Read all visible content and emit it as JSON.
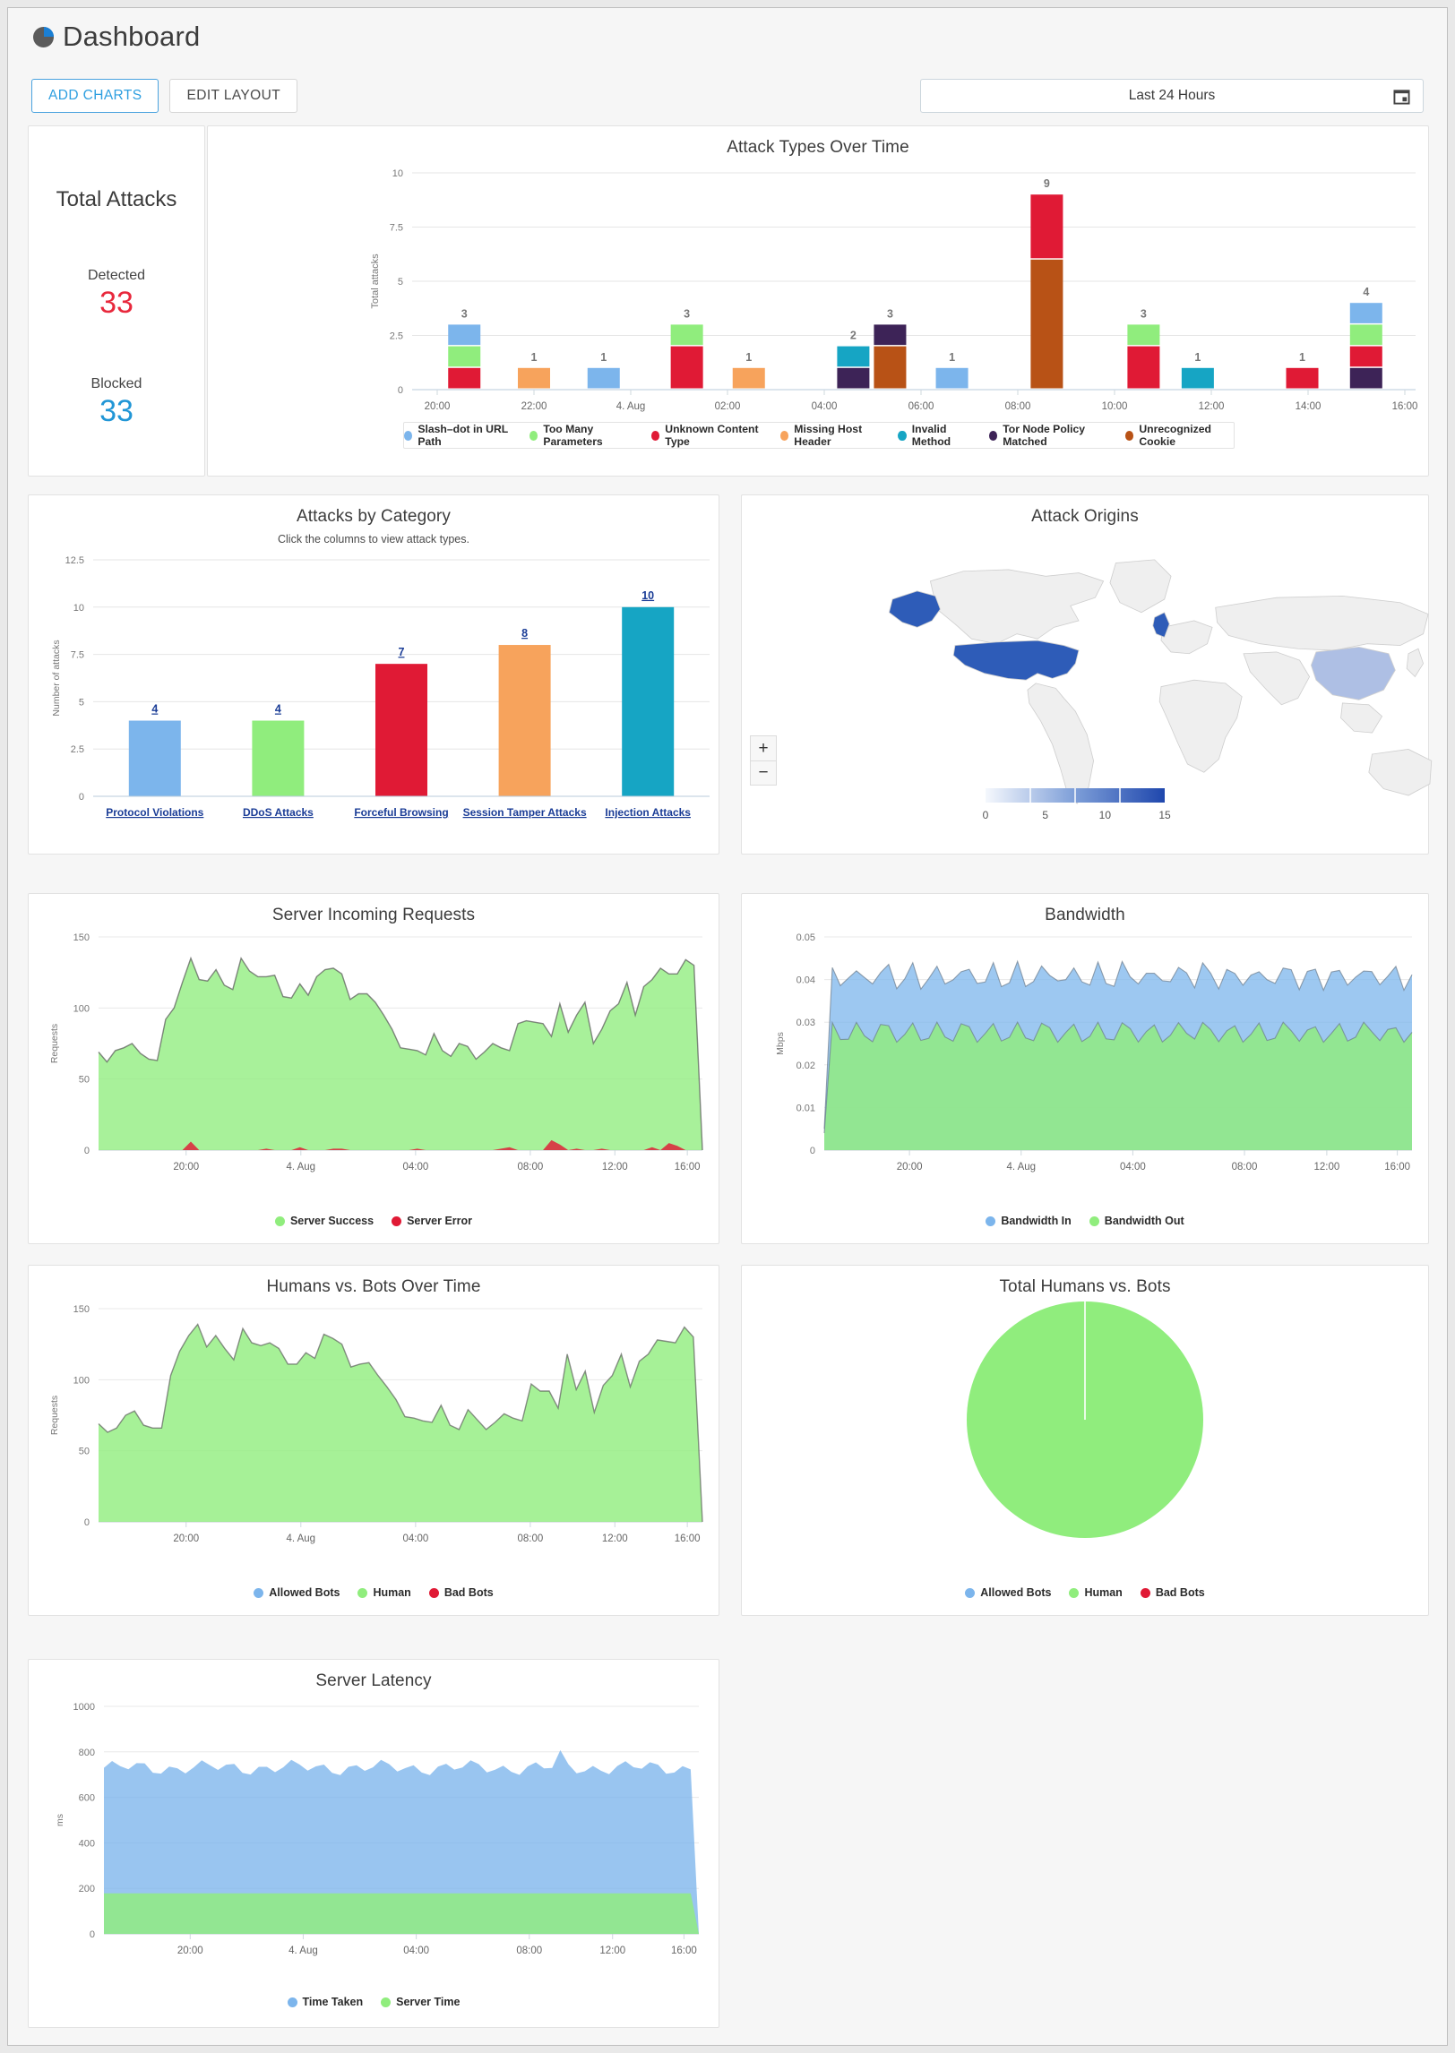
{
  "header": {
    "title": "Dashboard",
    "icon": "pie-chart-icon",
    "add_charts_label": "ADD CHARTS",
    "edit_layout_label": "EDIT LAYOUT",
    "time_range_value": "Last 24 Hours",
    "calendar_icon": "calendar-icon"
  },
  "total_attacks": {
    "title": "Total Attacks",
    "detected_label": "Detected",
    "detected_value": "33",
    "detected_color": "#e8283c",
    "blocked_label": "Blocked",
    "blocked_value": "33",
    "blocked_color": "#2196d6"
  },
  "map": {
    "zoom_in_label": "+",
    "zoom_out_label": "−",
    "legend_ticks": [
      "0",
      "5",
      "10",
      "15"
    ]
  },
  "chart_data": [
    {
      "id": "attack-types-over-time",
      "type": "bar",
      "title": "Attack Types Over Time",
      "xlabel": "",
      "ylabel": "Total attacks",
      "ylim": [
        0,
        10
      ],
      "yticks": [
        0,
        2.5,
        5,
        7.5,
        10
      ],
      "xticks": [
        "20:00",
        "22:00",
        "4. Aug",
        "02:00",
        "04:00",
        "06:00",
        "08:00",
        "10:00",
        "12:00",
        "14:00",
        "16:00"
      ],
      "stacked": true,
      "legend": [
        {
          "name": "Slash–dot in URL Path",
          "color": "#7cb5ec"
        },
        {
          "name": "Too Many Parameters",
          "color": "#90ed7d"
        },
        {
          "name": "Unknown Content Type",
          "color": "#e01a35"
        },
        {
          "name": "Missing Host Header",
          "color": "#f7a35c"
        },
        {
          "name": "Invalid Method",
          "color": "#16a5c4"
        },
        {
          "name": "Tor Node Policy Matched",
          "color": "#3d2357"
        },
        {
          "name": "Unrecognized Cookie",
          "color": "#b85216"
        }
      ],
      "bars": [
        {
          "time": "19:00",
          "total": 3,
          "segments": [
            {
              "series": "Unknown Content Type",
              "value": 1
            },
            {
              "series": "Too Many Parameters",
              "value": 1
            },
            {
              "series": "Slash–dot in URL Path",
              "value": 1
            }
          ]
        },
        {
          "time": "20:30",
          "total": 1,
          "segments": [
            {
              "series": "Missing Host Header",
              "value": 1
            }
          ]
        },
        {
          "time": "22:00",
          "total": 1,
          "segments": [
            {
              "series": "Slash–dot in URL Path",
              "value": 1
            }
          ]
        },
        {
          "time": "00:00",
          "total": 3,
          "segments": [
            {
              "series": "Unknown Content Type",
              "value": 2
            },
            {
              "series": "Too Many Parameters",
              "value": 1
            }
          ]
        },
        {
          "time": "01:00",
          "total": 1,
          "segments": [
            {
              "series": "Missing Host Header",
              "value": 1
            }
          ]
        },
        {
          "time": "04:00",
          "total": 2,
          "segments": [
            {
              "series": "Tor Node Policy Matched",
              "value": 1
            },
            {
              "series": "Invalid Method",
              "value": 1
            }
          ]
        },
        {
          "time": "04:45",
          "total": 3,
          "segments": [
            {
              "series": "Unrecognized Cookie",
              "value": 2
            },
            {
              "series": "Tor Node Policy Matched",
              "value": 1
            }
          ]
        },
        {
          "time": "06:00",
          "total": 1,
          "segments": [
            {
              "series": "Slash–dot in URL Path",
              "value": 1
            }
          ]
        },
        {
          "time": "08:20",
          "total": 9,
          "segments": [
            {
              "series": "Unrecognized Cookie",
              "value": 6
            },
            {
              "series": "Unknown Content Type",
              "value": 3
            }
          ]
        },
        {
          "time": "11:00",
          "total": 3,
          "segments": [
            {
              "series": "Unknown Content Type",
              "value": 2
            },
            {
              "series": "Too Many Parameters",
              "value": 1
            }
          ]
        },
        {
          "time": "12:00",
          "total": 1,
          "segments": [
            {
              "series": "Invalid Method",
              "value": 1
            }
          ]
        },
        {
          "time": "14:30",
          "total": 1,
          "segments": [
            {
              "series": "Unknown Content Type",
              "value": 1
            }
          ]
        },
        {
          "time": "15:45",
          "total": 4,
          "segments": [
            {
              "series": "Tor Node Policy Matched",
              "value": 1
            },
            {
              "series": "Unknown Content Type",
              "value": 1
            },
            {
              "series": "Too Many Parameters",
              "value": 1
            },
            {
              "series": "Slash–dot in URL Path",
              "value": 1
            }
          ]
        }
      ]
    },
    {
      "id": "attacks-by-category",
      "type": "bar",
      "title": "Attacks by Category",
      "subtitle": "Click the columns to view attack types.",
      "xlabel": "",
      "ylabel": "Number of attacks",
      "ylim": [
        0,
        12.5
      ],
      "yticks": [
        0,
        2.5,
        5,
        7.5,
        10,
        12.5
      ],
      "categories": [
        "Protocol Violations",
        "DDoS Attacks",
        "Forceful Browsing",
        "Session Tamper Attacks",
        "Injection Attacks"
      ],
      "values": [
        4,
        4,
        7,
        8,
        10
      ],
      "colors": [
        "#7cb5ec",
        "#90ed7d",
        "#e01a35",
        "#f7a35c",
        "#16a5c4"
      ],
      "label_color": "#1a3c96"
    },
    {
      "id": "attack-origins",
      "type": "heatmap",
      "title": "Attack Origins",
      "legend_ticks": [
        0,
        5,
        10,
        15
      ],
      "regions": [
        {
          "name": "United States",
          "value": 15
        },
        {
          "name": "Alaska",
          "value": 15
        },
        {
          "name": "United Kingdom",
          "value": 15
        },
        {
          "name": "China",
          "value": 5
        }
      ]
    },
    {
      "id": "server-incoming-requests",
      "type": "area",
      "title": "Server Incoming Requests",
      "xlabel": "",
      "ylabel": "Requests",
      "ylim": [
        0,
        150
      ],
      "yticks": [
        0,
        50,
        100,
        150
      ],
      "xticks": [
        "20:00",
        "4. Aug",
        "04:00",
        "08:00",
        "12:00",
        "16:00"
      ],
      "series": [
        {
          "name": "Server Success",
          "color": "#90ed7d",
          "values": [
            69,
            62,
            70,
            72,
            75,
            68,
            64,
            63,
            92,
            100,
            118,
            135,
            120,
            119,
            127,
            116,
            113,
            135,
            126,
            122,
            122,
            123,
            108,
            107,
            117,
            109,
            122,
            127,
            128,
            124,
            106,
            110,
            110,
            104,
            95,
            85,
            72,
            71,
            70,
            67,
            82,
            70,
            66,
            75,
            73,
            64,
            69,
            75,
            72,
            70,
            89,
            91,
            90,
            89,
            80,
            103,
            83,
            95,
            104,
            75,
            85,
            98,
            103,
            118,
            95,
            115,
            120,
            128,
            124,
            124,
            134,
            130,
            0
          ]
        },
        {
          "name": "Server Error",
          "color": "#e01a35",
          "values": [
            0,
            0,
            0,
            0,
            0,
            0,
            0,
            0,
            0,
            0,
            0,
            6,
            0,
            0,
            0,
            0,
            0,
            0,
            0,
            0,
            1,
            0,
            0,
            0,
            2,
            0,
            0,
            0,
            1,
            1,
            0,
            0,
            0,
            0,
            0,
            0,
            0,
            0,
            1,
            0,
            0,
            0,
            0,
            0,
            0,
            0,
            0,
            0,
            1,
            2,
            0,
            0,
            0,
            0,
            7,
            4,
            0,
            1,
            0,
            0,
            1,
            0,
            0,
            0,
            0,
            0,
            2,
            0,
            5,
            3,
            0,
            0,
            0
          ]
        }
      ]
    },
    {
      "id": "bandwidth",
      "type": "area",
      "title": "Bandwidth",
      "xlabel": "",
      "ylabel": "Mbps",
      "ylim": [
        0,
        0.05
      ],
      "yticks": [
        0,
        0.01,
        0.02,
        0.03,
        0.04,
        0.05
      ],
      "xticks": [
        "20:00",
        "4. Aug",
        "04:00",
        "08:00",
        "12:00",
        "16:00"
      ],
      "series": [
        {
          "name": "Bandwidth Out",
          "color": "#90ed7d",
          "approx_value": 0.028
        },
        {
          "name": "Bandwidth In",
          "color": "#7cb5ec",
          "approx_top": 0.042
        }
      ]
    },
    {
      "id": "humans-vs-bots-over-time",
      "type": "area",
      "title": "Humans vs. Bots Over Time",
      "xlabel": "",
      "ylabel": "Requests",
      "ylim": [
        0,
        150
      ],
      "yticks": [
        0,
        50,
        100,
        150
      ],
      "xticks": [
        "20:00",
        "4. Aug",
        "04:00",
        "08:00",
        "12:00",
        "16:00"
      ],
      "series": [
        {
          "name": "Allowed Bots",
          "color": "#7cb5ec",
          "values": []
        },
        {
          "name": "Human",
          "color": "#90ed7d",
          "values": [
            69,
            63,
            66,
            75,
            78,
            68,
            66,
            66,
            103,
            120,
            131,
            139,
            123,
            131,
            122,
            114,
            136,
            126,
            124,
            126,
            122,
            111,
            111,
            119,
            115,
            132,
            129,
            125,
            109,
            111,
            112,
            103,
            95,
            86,
            74,
            73,
            71,
            70,
            82,
            68,
            65,
            79,
            72,
            65,
            70,
            76,
            73,
            71,
            97,
            92,
            92,
            80,
            118,
            93,
            106,
            77,
            96,
            103,
            118,
            95,
            113,
            118,
            128,
            127,
            126,
            137,
            130,
            0
          ]
        },
        {
          "name": "Bad Bots",
          "color": "#e01a35",
          "values": []
        }
      ]
    },
    {
      "id": "total-humans-vs-bots",
      "type": "pie",
      "title": "Total Humans vs. Bots",
      "labels": [
        "Allowed Bots",
        "Human",
        "Bad Bots"
      ],
      "colors": [
        "#7cb5ec",
        "#90ed7d",
        "#e01a35"
      ],
      "values": [
        0,
        100,
        0
      ]
    },
    {
      "id": "server-latency",
      "type": "area",
      "title": "Server Latency",
      "xlabel": "",
      "ylabel": "ms",
      "ylim": [
        0,
        1000
      ],
      "yticks": [
        0,
        200,
        400,
        600,
        800,
        1000
      ],
      "xticks": [
        "20:00",
        "4. Aug",
        "04:00",
        "08:00",
        "12:00",
        "16:00"
      ],
      "series": [
        {
          "name": "Server Time",
          "color": "#90ed7d",
          "approx_value": 180
        },
        {
          "name": "Time Taken",
          "color": "#7cb5ec",
          "approx_top": 735
        }
      ]
    }
  ]
}
